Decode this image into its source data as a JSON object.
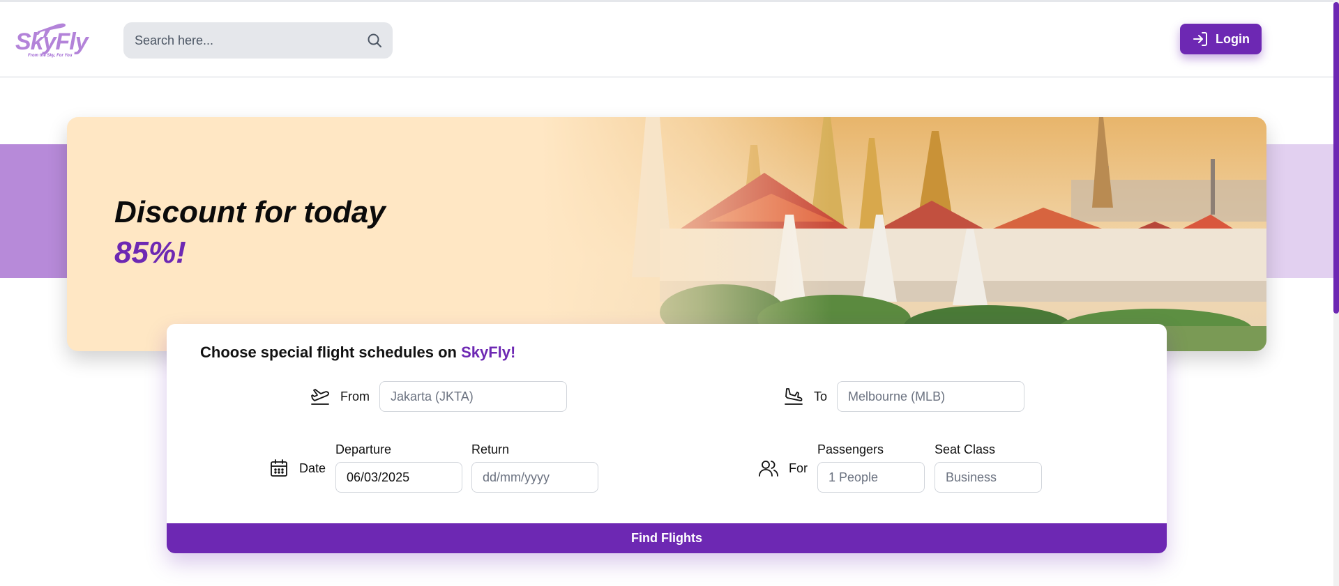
{
  "app": {
    "logo_text": "SkyFly",
    "logo_tagline": "From the Sky, For You"
  },
  "header": {
    "search_placeholder": "Search here...",
    "login_label": "Login"
  },
  "hero": {
    "title": "Discount for today",
    "discount": "85%!"
  },
  "booking": {
    "title_prefix": "Choose special flight schedules on ",
    "title_brand": "SkyFly!",
    "from_label": "From",
    "from_placeholder": "Jakarta (JKTA)",
    "to_label": "To",
    "to_placeholder": "Melbourne (MLB)",
    "date_label": "Date",
    "departure_label": "Departure",
    "departure_value": "06/03/2025",
    "return_label": "Return",
    "return_placeholder": "dd/mm/yyyy",
    "for_label": "For",
    "passengers_label": "Passengers",
    "passengers_placeholder": "1 People",
    "seat_class_label": "Seat Class",
    "seat_class_placeholder": "Business",
    "find_label": "Find Flights"
  },
  "colors": {
    "brand": "#6d28b3",
    "hero_bg": "#ffe7c4",
    "band_left": "#b78ad9",
    "band_right": "#e2d0f0"
  },
  "icons": [
    "search-icon",
    "login-icon",
    "takeoff-icon",
    "landing-icon",
    "calendar-icon",
    "users-icon",
    "plane-logo-icon"
  ]
}
